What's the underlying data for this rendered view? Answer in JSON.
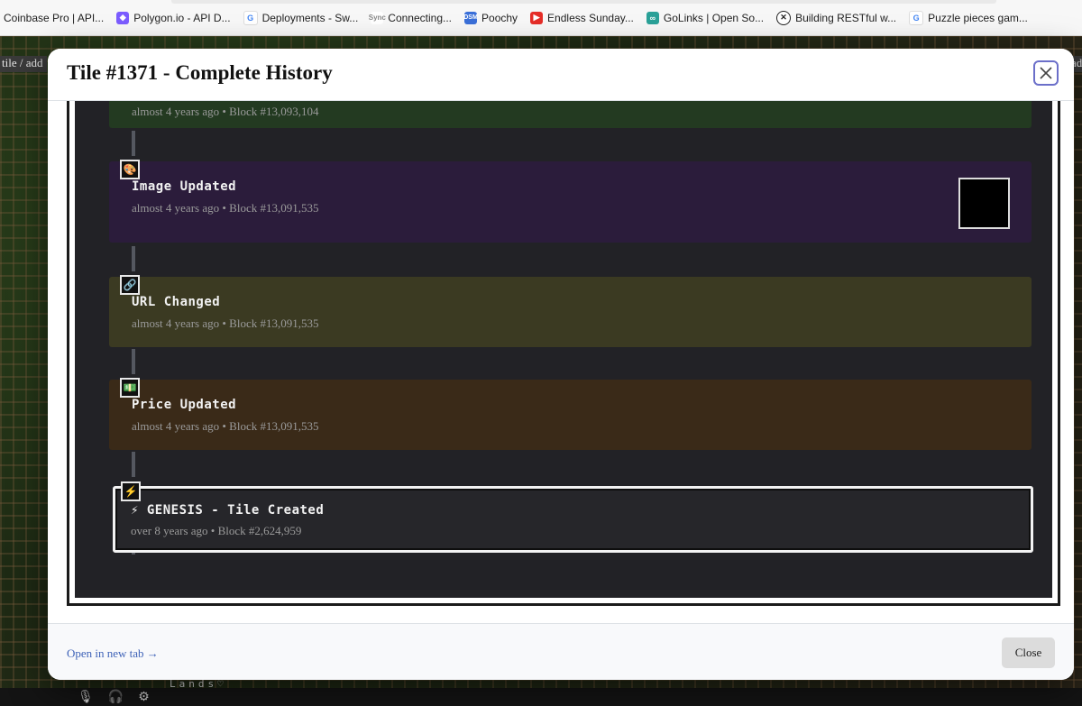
{
  "bookmarks": [
    {
      "label": "Coinbase Pro | API...",
      "icon": "coinbase-icon",
      "color": "#ffffff"
    },
    {
      "label": "Polygon.io - API D...",
      "icon": "polygon-icon",
      "color": "#7b5cff"
    },
    {
      "label": "Deployments - Sw...",
      "icon": "google-icon",
      "color": "#4285f4"
    },
    {
      "label": "Connecting...",
      "icon": "sync-icon",
      "color": "#888888"
    },
    {
      "label": "Poochy",
      "icon": "dsm-icon",
      "color": "#3a6fd8"
    },
    {
      "label": "Endless Sunday...",
      "icon": "youtube-icon",
      "color": "#e52d27"
    },
    {
      "label": "GoLinks | Open So...",
      "icon": "golinks-icon",
      "color": "#2aa198"
    },
    {
      "label": "Building RESTful w...",
      "icon": "x-circle-icon",
      "color": "#222222"
    },
    {
      "label": "Puzzle pieces gam...",
      "icon": "google-icon",
      "color": "#4285f4"
    }
  ],
  "background": {
    "left_hint": "tile / add",
    "right_hint": "add",
    "lands_label": "Lands♡"
  },
  "modal": {
    "title": "Tile #1371 - Complete History",
    "close_icon": "close-icon",
    "events": [
      {
        "title": "",
        "meta": "almost 4 years ago • Block #13,093,104",
        "color": "#233a21",
        "icon": ""
      },
      {
        "title": "Image Updated",
        "meta": "almost 4 years ago • Block #13,091,535",
        "color": "#2b1c3b",
        "icon": "🎨"
      },
      {
        "title": "URL Changed",
        "meta": "almost 4 years ago • Block #13,091,535",
        "color": "#3b3a22",
        "icon": "🔗"
      },
      {
        "title": "Price Updated",
        "meta": "almost 4 years ago • Block #13,091,535",
        "color": "#3a2a18",
        "icon": "💵"
      },
      {
        "title": "⚡ GENESIS - Tile Created",
        "meta": "over 8 years ago • Block #2,624,959",
        "color": "#26262a",
        "icon": "⚡"
      }
    ],
    "footer": {
      "open_link": "Open in new tab →",
      "close_label": "Close"
    }
  }
}
